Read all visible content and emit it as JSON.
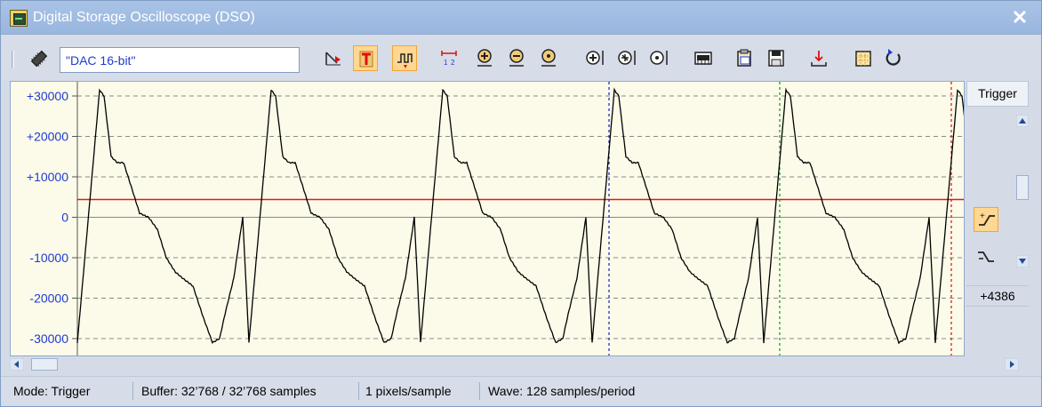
{
  "window": {
    "title": "Digital Storage Oscilloscope (DSO)",
    "close_label": "✕"
  },
  "toolbar": {
    "source_value": "\"DAC 16-bit\"",
    "buttons": [
      "trigger-marker-icon",
      "trigger-mode-icon",
      "single-shot-icon",
      "scale-icon",
      "zoom-in-icon",
      "zoom-out-icon",
      "zoom-reset-icon",
      "zoom-in-y-icon",
      "zoom-fit-y-icon",
      "zoom-reset-y-icon",
      "memory-icon",
      "copy-icon",
      "save-icon",
      "export-icon",
      "grid-icon",
      "refresh-icon"
    ]
  },
  "plot": {
    "y_ticks": [
      "+30000",
      "+20000",
      "+10000",
      "0",
      "-10000",
      "-20000",
      "-30000"
    ],
    "trigger_level": 4386,
    "colors": {
      "background": "#fcfbe9",
      "signal": "#000000",
      "trigger_line": "#e11818",
      "cursor_blue": "#1f2fd2",
      "cursor_green": "#15a22c",
      "cursor_red": "#e11818",
      "tick_text": "#1f3ad2"
    }
  },
  "right_panel": {
    "trigger_label": "Trigger",
    "level_value": "+4386"
  },
  "status": {
    "mode": "Mode: Trigger",
    "buffer": "Buffer:  32’768 / 32’768 samples",
    "pixels": "1 pixels/sample",
    "wave": "Wave: 128 samples/period"
  }
}
